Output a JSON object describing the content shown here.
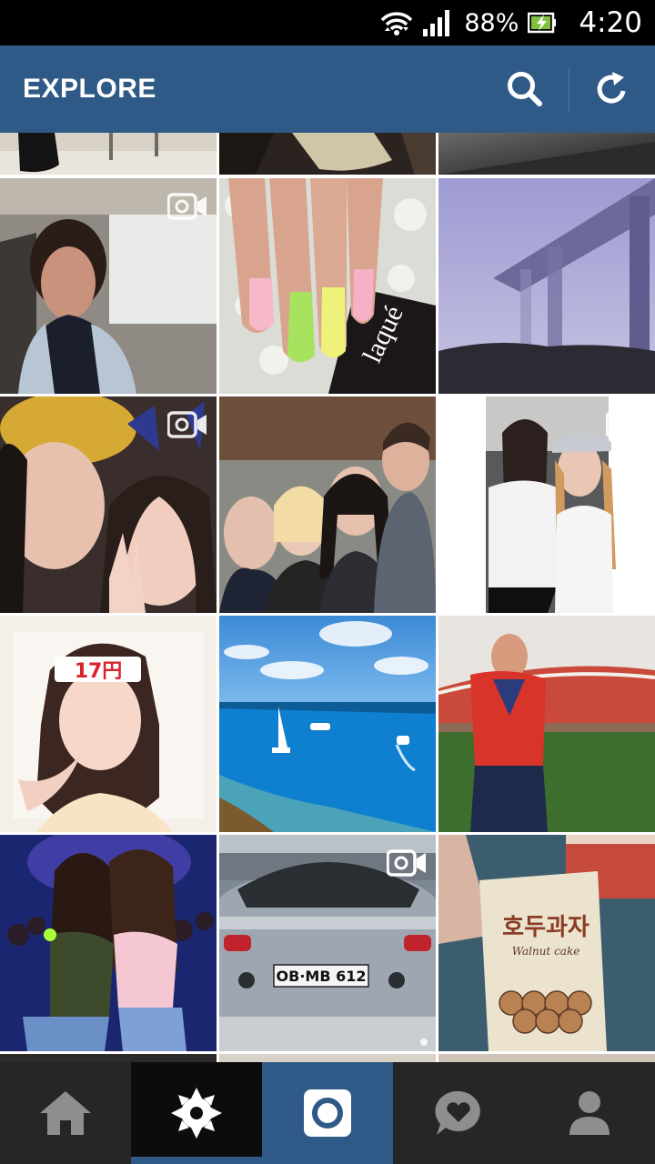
{
  "status_bar": {
    "battery_percent": "88%",
    "time": "4:20",
    "icons": [
      "wifi-icon",
      "signal-icon",
      "battery-charging-icon"
    ]
  },
  "header": {
    "title": "EXPLORE",
    "actions": [
      "search-icon",
      "refresh-icon"
    ]
  },
  "grid": {
    "tiles": [
      {
        "row": 0,
        "col": 0,
        "video": false
      },
      {
        "row": 0,
        "col": 1,
        "video": false
      },
      {
        "row": 0,
        "col": 2,
        "video": false
      },
      {
        "row": 1,
        "col": 0,
        "video": true
      },
      {
        "row": 1,
        "col": 1,
        "video": false,
        "text": "laqué"
      },
      {
        "row": 1,
        "col": 2,
        "video": false
      },
      {
        "row": 2,
        "col": 0,
        "video": true
      },
      {
        "row": 2,
        "col": 1,
        "video": false
      },
      {
        "row": 2,
        "col": 2,
        "video": true
      },
      {
        "row": 3,
        "col": 0,
        "video": false
      },
      {
        "row": 3,
        "col": 1,
        "video": false
      },
      {
        "row": 3,
        "col": 2,
        "video": false
      },
      {
        "row": 4,
        "col": 0,
        "video": false
      },
      {
        "row": 4,
        "col": 1,
        "video": true,
        "text": "OB·MB 612"
      },
      {
        "row": 4,
        "col": 2,
        "video": false,
        "text": "호두과자",
        "subtext": "Walnut cake"
      }
    ]
  },
  "bottom_nav": {
    "items": [
      "home-icon",
      "explore-icon",
      "camera-icon",
      "activity-icon",
      "profile-icon"
    ],
    "active": "explore-icon"
  },
  "colors": {
    "header_bg": "#2f5a87",
    "nav_bg": "#262626",
    "nav_active_bg": "#0c0c0c"
  }
}
